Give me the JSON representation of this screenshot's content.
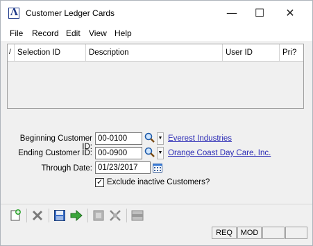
{
  "window": {
    "title": "Customer Ledger Cards",
    "controls": {
      "minimize": "—",
      "maximize": "☐",
      "close": "✕"
    }
  },
  "menu": [
    "File",
    "Record",
    "Edit",
    "View",
    "Help"
  ],
  "grid": {
    "sort_glyph": "/",
    "columns": [
      "Selection ID",
      "Description",
      "User ID",
      "Pri?"
    ]
  },
  "form": {
    "beginning_customer": {
      "label": "Beginning Customer ID:",
      "value": "00-0100",
      "name": "Everest Industries"
    },
    "ending_customer": {
      "label": "Ending Customer ID:",
      "value": "00-0900",
      "name": "Orange Coast Day Care, Inc."
    },
    "through_date": {
      "label": "Through Date:",
      "value": "01/23/2017"
    },
    "exclude_inactive": {
      "label": "Exclude inactive Customers?",
      "checked": true,
      "mark": "✓"
    }
  },
  "status": {
    "req": "REQ",
    "mod": "MOD"
  },
  "toolbar": {
    "icons": [
      "new-record-icon",
      "delete-icon",
      "save-icon",
      "proceed-icon",
      "print-icon",
      "collapse-icon",
      "layout-icon"
    ]
  }
}
